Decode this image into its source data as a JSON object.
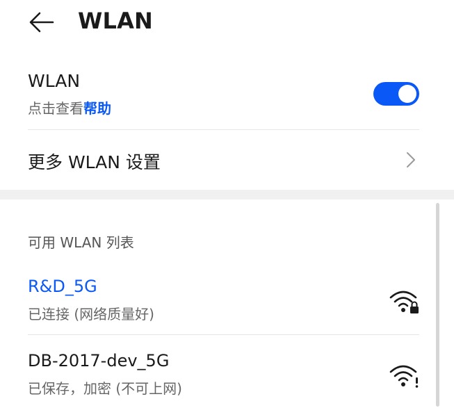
{
  "header": {
    "title": "WLAN"
  },
  "wlan": {
    "title": "WLAN",
    "subtitle_prefix": "点击查看",
    "help_link": "帮助",
    "enabled": true
  },
  "more_settings": {
    "label": "更多 WLAN 设置"
  },
  "available": {
    "section_title": "可用 WLAN 列表",
    "networks": [
      {
        "name": "R&D_5G",
        "status": "已连接 (网络质量好)",
        "connected": true,
        "icon": "wifi-lock-icon"
      },
      {
        "name": "DB-2017-dev_5G",
        "status": "已保存，加密 (不可上网)",
        "connected": false,
        "icon": "wifi-warning-icon"
      }
    ]
  },
  "colors": {
    "accent": "#0a59f7",
    "section_gap": "#f1f1f1"
  }
}
